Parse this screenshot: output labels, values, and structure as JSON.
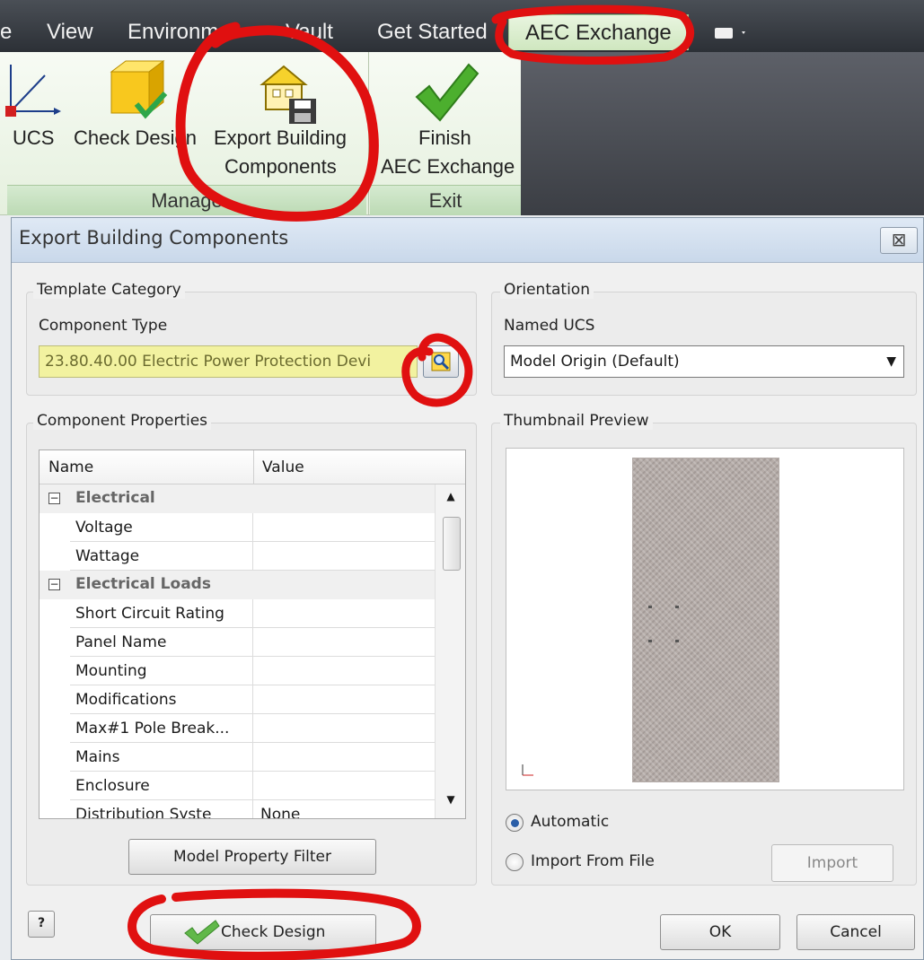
{
  "ribbon": {
    "tabs": {
      "partial": "e",
      "view": "View",
      "environments": "Environments",
      "vault": "Vault",
      "get_started": "Get Started",
      "aec_exchange": "AEC Exchange"
    },
    "buttons": {
      "ucs": "UCS",
      "check_design": "Check Design",
      "export_line1": "Export Building",
      "export_line2": "Components",
      "finish_line1": "Finish",
      "finish_line2": "AEC Exchange"
    },
    "groups": {
      "manage": "Manage",
      "exit": "Exit"
    }
  },
  "dialog": {
    "title": "Export Building Components",
    "close_symbol": "⊠",
    "template_category": {
      "title": "Template Category",
      "component_type_label": "Component Type",
      "component_type_value": "23.80.40.00  Electric Power Protection Devi"
    },
    "orientation": {
      "title": "Orientation",
      "named_ucs_label": "Named UCS",
      "named_ucs_value": "Model Origin (Default)"
    },
    "component_properties": {
      "title": "Component Properties",
      "columns": {
        "name": "Name",
        "value": "Value"
      },
      "categories": [
        "Electrical",
        "Electrical Loads"
      ],
      "rows": [
        {
          "name": "Voltage",
          "value": ""
        },
        {
          "name": "Wattage",
          "value": ""
        },
        {
          "name": "Short Circuit Rating",
          "value": ""
        },
        {
          "name": "Panel Name",
          "value": ""
        },
        {
          "name": "Mounting",
          "value": ""
        },
        {
          "name": "Modifications",
          "value": ""
        },
        {
          "name": "Max#1 Pole Break...",
          "value": ""
        },
        {
          "name": "Mains",
          "value": ""
        },
        {
          "name": "Enclosure",
          "value": ""
        },
        {
          "name": "Distribution Syste",
          "value": "None"
        }
      ],
      "filter_button": "Model Property Filter"
    },
    "thumbnail": {
      "title": "Thumbnail Preview",
      "automatic": "Automatic",
      "import_from_file": "Import From File",
      "import_button": "Import",
      "selected": "automatic"
    },
    "footer": {
      "help_symbol": "?",
      "check_design": "Check Design",
      "ok": "OK",
      "cancel": "Cancel"
    }
  },
  "colors": {
    "annotation_red": "#e01010",
    "highlight_yellow": "#f2f2a0",
    "radio_accent": "#2b5fa8"
  }
}
